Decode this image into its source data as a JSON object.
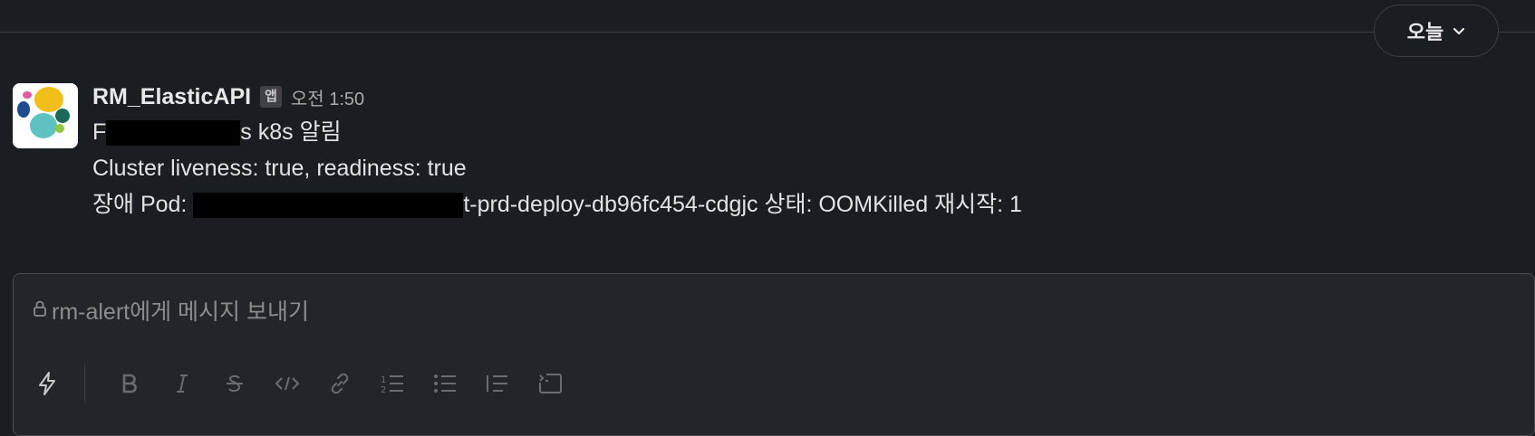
{
  "date_pill": {
    "label": "오늘"
  },
  "message": {
    "sender": "RM_ElasticAPI",
    "badge": "앱",
    "time": "오전 1:50",
    "line1_prefix": "F",
    "line1_suffix": "s k8s 알림",
    "line2": "Cluster liveness: true, readiness: true",
    "line3_prefix": "장애 Pod: ",
    "line3_suffix": "t-prd-deploy-db96fc454-cdgjc 상태: OOMKilled 재시작: 1"
  },
  "composer": {
    "placeholder": "rm-alert에게 메시지 보내기",
    "toolbar_icons": [
      "shortcuts-bolt-icon",
      "bold-icon",
      "italic-icon",
      "strikethrough-icon",
      "code-icon",
      "link-icon",
      "ordered-list-icon",
      "bulleted-list-icon",
      "blockquote-icon",
      "code-block-icon"
    ]
  },
  "colors": {
    "background": "#1a1d21",
    "composer_bg": "#222529",
    "text": "#e2e3e4",
    "muted": "#8b8c8e"
  }
}
